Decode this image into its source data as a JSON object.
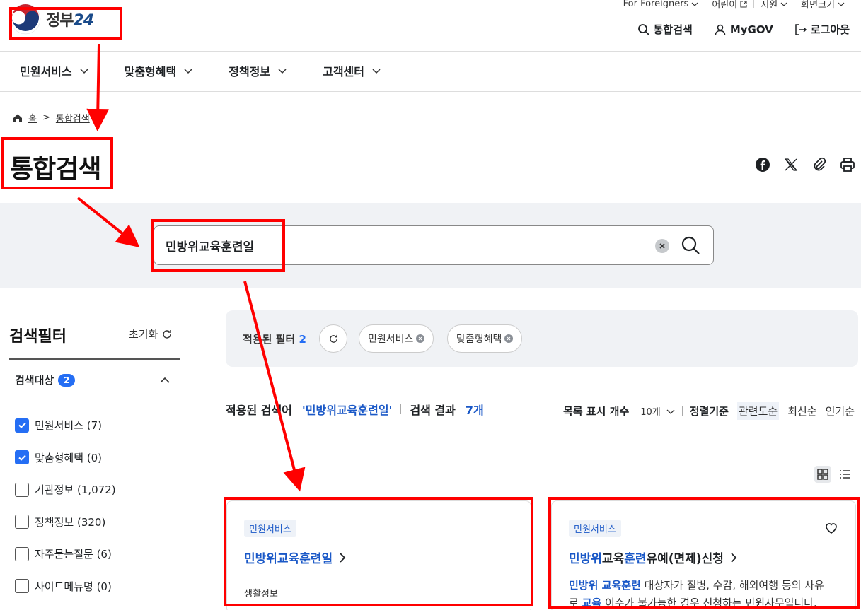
{
  "utility_nav": {
    "items": [
      "For Foreigners",
      "어린이",
      "지원",
      "화면크기"
    ]
  },
  "logo": {
    "text": "정부",
    "number": "24"
  },
  "top_nav": {
    "search": "통합검색",
    "mygov": "MyGOV",
    "logout": "로그아웃"
  },
  "main_nav": {
    "items": [
      "민원서비스",
      "맞춤형혜택",
      "정책정보",
      "고객센터"
    ]
  },
  "breadcrumb": {
    "home": "홈",
    "current": "통합검색"
  },
  "page_title": "통합검색",
  "search": {
    "value": "민방위교육훈련일"
  },
  "filter": {
    "title": "검색필터",
    "reset": "초기화",
    "group_label": "검색대상",
    "group_count": "2",
    "options": [
      {
        "label": "민원서비스 (7)",
        "checked": true
      },
      {
        "label": "맞춤형혜택 (0)",
        "checked": true
      },
      {
        "label": "기관정보 (1,072)",
        "checked": false
      },
      {
        "label": "정책정보 (320)",
        "checked": false
      },
      {
        "label": "자주묻는질문 (6)",
        "checked": false
      },
      {
        "label": "사이트메뉴명 (0)",
        "checked": false
      }
    ]
  },
  "applied_filters": {
    "label": "적용된 필터",
    "count": "2",
    "chips": [
      "민원서비스",
      "맞춤형혜택"
    ]
  },
  "results": {
    "keyword_label": "적용된 검색어",
    "keyword": "'민방위교육훈련일'",
    "result_label": "검색 결과",
    "result_count": "7개",
    "list_count_label": "목록 표시 개수",
    "list_count_value": "10개",
    "sort_label": "정렬기준",
    "sort_options": [
      "관련도순",
      "최신순",
      "인기순"
    ]
  },
  "cards": [
    {
      "tag": "민원서비스",
      "title": "민방위교육훈련일",
      "sub": "생활정보"
    },
    {
      "tag": "민원서비스",
      "title_parts": [
        "민방위",
        "교육",
        "훈련",
        "유예(면제)신청"
      ],
      "desc_line1_hl": "민방위 교육훈련",
      "desc_line1_rest": " 대상자가 질병, 수감, 해외여행 등의 사유",
      "desc_line2_pre": "로 ",
      "desc_line2_hl": "교육",
      "desc_line2_rest": " 이수가 불가능한 경우 신청하는 민원사무입니다."
    }
  ],
  "colors": {
    "accent_blue": "#256ef4",
    "link_blue": "#1a58c7",
    "annotation_red": "#ff0000",
    "band_gray": "#f0f2f5"
  }
}
